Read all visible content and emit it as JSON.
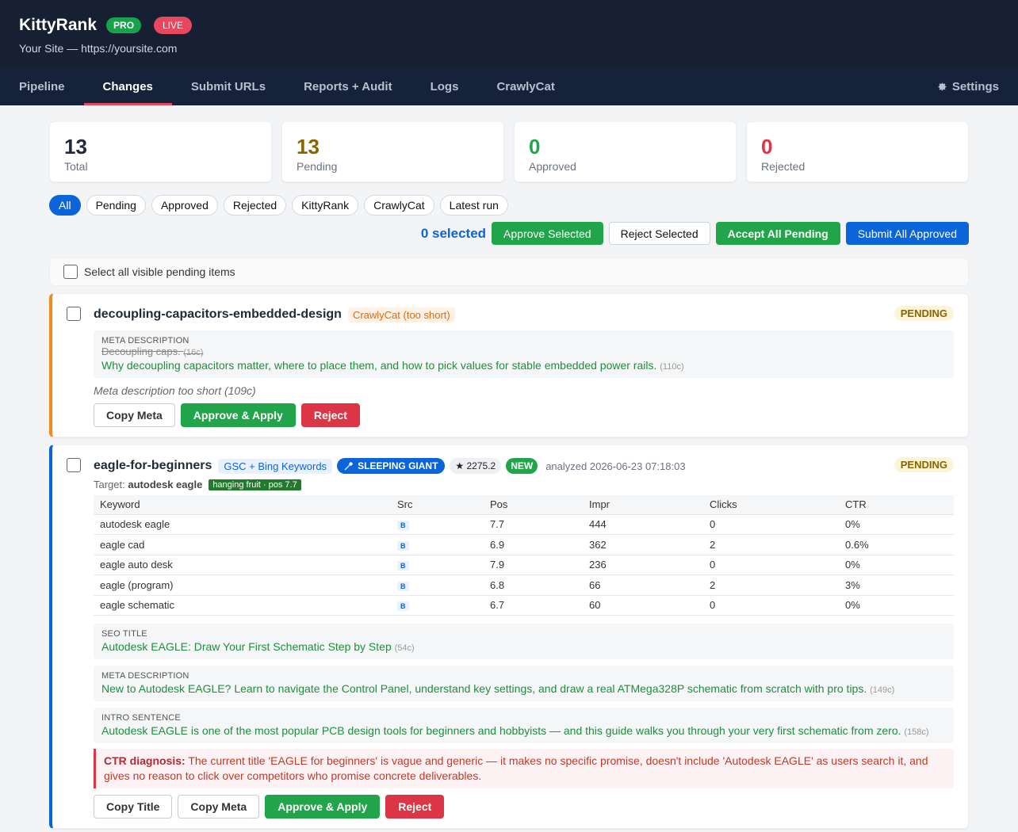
{
  "app": {
    "name": "KittyRank",
    "pro_badge": "PRO",
    "live_badge": "LIVE",
    "site_line": "Your Site — https://yoursite.com"
  },
  "nav": {
    "tabs": [
      "Pipeline",
      "Changes",
      "Submit URLs",
      "Reports + Audit",
      "Logs",
      "CrawlyCat"
    ],
    "active": "Changes",
    "settings_label": "Settings",
    "settings_icon": "gear-icon"
  },
  "stats": [
    {
      "value": "13",
      "label": "Total",
      "color": "#1f2937"
    },
    {
      "value": "13",
      "label": "Pending",
      "color": "#8a6400"
    },
    {
      "value": "0",
      "label": "Approved",
      "color": "#22a54a"
    },
    {
      "value": "0",
      "label": "Rejected",
      "color": "#dc3545"
    }
  ],
  "filters": [
    "All",
    "Pending",
    "Approved",
    "Rejected",
    "KittyRank",
    "CrawlyCat",
    "Latest run"
  ],
  "actions": {
    "selected": "0 selected",
    "approve_selected": "Approve Selected",
    "reject_selected": "Reject Selected",
    "accept_all": "Accept All Pending",
    "submit_all": "Submit All Approved"
  },
  "select_all_label": "Select all visible pending items",
  "cards": [
    {
      "slug": "decoupling-capacitors-embedded-design",
      "source": "CrawlyCat (too short)",
      "status": "PENDING",
      "field_label": "META DESCRIPTION",
      "old_value": "Decoupling caps.",
      "old_count": "(16c)",
      "new_value": "Why decoupling capacitors matter, where to place them, and how to pick values for stable embedded power rails.",
      "new_count": "(110c)",
      "note": "Meta description too short (109c)",
      "buttons": [
        "Copy Meta",
        "Approve & Apply",
        "Reject"
      ]
    },
    {
      "slug": "eagle-for-beginners",
      "source": "GSC + Bing Keywords",
      "sleeping_giant": "SLEEPING GIANT",
      "sleeping_icon": "comet-icon",
      "score": "★ 2275.2",
      "new_badge": "NEW",
      "analyzed": "analyzed 2026-06-23 07:18:03",
      "status": "PENDING",
      "target_label": "Target:",
      "target_value": "autodesk eagle",
      "hanging_fruit": "hanging fruit · pos 7.7",
      "table": {
        "headers": [
          "Keyword",
          "Src",
          "Pos",
          "Impr",
          "Clicks",
          "CTR"
        ],
        "rows": [
          [
            "autodesk eagle",
            "B",
            "7.7",
            "444",
            "0",
            "0%"
          ],
          [
            "eagle cad",
            "B",
            "6.9",
            "362",
            "2",
            "0.6%"
          ],
          [
            "eagle auto desk",
            "B",
            "7.9",
            "236",
            "0",
            "0%"
          ],
          [
            "eagle (program)",
            "B",
            "6.8",
            "66",
            "2",
            "3%"
          ],
          [
            "eagle schematic",
            "B",
            "6.7",
            "60",
            "0",
            "0%"
          ]
        ]
      },
      "fields": [
        {
          "label": "SEO TITLE",
          "value": "Autodesk EAGLE: Draw Your First Schematic Step by Step",
          "count": "(54c)"
        },
        {
          "label": "META DESCRIPTION",
          "value": "New to Autodesk EAGLE? Learn to navigate the Control Panel, understand key settings, and draw a real ATMega328P schematic from scratch with pro tips.",
          "count": "(149c)"
        },
        {
          "label": "INTRO SENTENCE",
          "value": "Autodesk EAGLE is one of the most popular PCB design tools for beginners and hobbyists — and this guide walks you through your very first schematic from zero.",
          "count": "(158c)"
        }
      ],
      "diagnosis_label": "CTR diagnosis:",
      "diagnosis_text": "The current title 'EAGLE for beginners' is vague and generic — it makes no specific promise, doesn't include 'Autodesk EAGLE' as users search it, and gives no reason to click over competitors who promise concrete deliverables.",
      "buttons": [
        "Copy Title",
        "Copy Meta",
        "Approve & Apply",
        "Reject"
      ]
    }
  ]
}
